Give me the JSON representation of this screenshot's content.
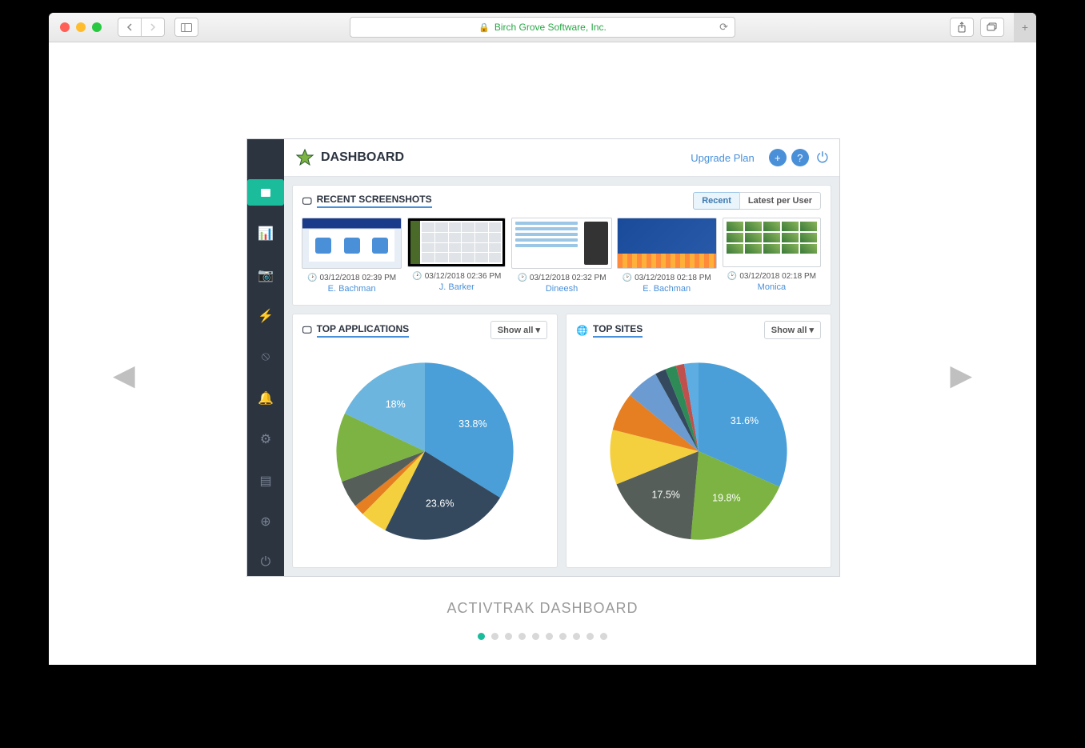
{
  "browser": {
    "page_title": "Birch Grove Software, Inc."
  },
  "caption": "ACTIVTRAK DASHBOARD",
  "pagers": {
    "count": 10,
    "active": 0
  },
  "header": {
    "title": "DASHBOARD",
    "upgrade": "Upgrade Plan"
  },
  "panels": {
    "screenshots": {
      "title": "RECENT SCREENSHOTS",
      "tabs": {
        "recent": "Recent",
        "latest": "Latest per User"
      }
    },
    "top_apps": {
      "title": "TOP APPLICATIONS",
      "dropdown": "Show all"
    },
    "top_sites": {
      "title": "TOP SITES",
      "dropdown": "Show all"
    }
  },
  "screenshots": [
    {
      "ts": "03/12/2018 02:39 PM",
      "user": "E. Bachman"
    },
    {
      "ts": "03/12/2018 02:36 PM",
      "user": "J. Barker"
    },
    {
      "ts": "03/12/2018 02:32 PM",
      "user": "Dineesh"
    },
    {
      "ts": "03/12/2018 02:18 PM",
      "user": "E. Bachman"
    },
    {
      "ts": "03/12/2018 02:18 PM",
      "user": "Monica"
    }
  ],
  "chart_data": [
    {
      "type": "pie",
      "title": "TOP APPLICATIONS",
      "slices": [
        {
          "value": 33.8,
          "color": "#4a9fd8",
          "label": "33.8%"
        },
        {
          "value": 23.6,
          "color": "#34495e",
          "label": "23.6%"
        },
        {
          "value": 5.0,
          "color": "#f4d03f",
          "label": ""
        },
        {
          "value": 2.0,
          "color": "#e67e22",
          "label": ""
        },
        {
          "value": 5.0,
          "color": "#555e58",
          "label": ""
        },
        {
          "value": 12.6,
          "color": "#7cb342",
          "label": ""
        },
        {
          "value": 18.0,
          "color": "#6bb5df",
          "label": "18%"
        }
      ]
    },
    {
      "type": "pie",
      "title": "TOP SITES",
      "slices": [
        {
          "value": 31.6,
          "color": "#4a9fd8",
          "label": "31.6%"
        },
        {
          "value": 19.8,
          "color": "#7cb342",
          "label": "19.8%"
        },
        {
          "value": 17.5,
          "color": "#555e58",
          "label": "17.5%"
        },
        {
          "value": 10.0,
          "color": "#f4d03f",
          "label": ""
        },
        {
          "value": 7.0,
          "color": "#e67e22",
          "label": ""
        },
        {
          "value": 6.0,
          "color": "#6b9bd1",
          "label": ""
        },
        {
          "value": 2.0,
          "color": "#34495e",
          "label": ""
        },
        {
          "value": 2.0,
          "color": "#2e8b57",
          "label": ""
        },
        {
          "value": 1.5,
          "color": "#c0504d",
          "label": ""
        },
        {
          "value": 2.6,
          "color": "#5dade2",
          "label": ""
        }
      ]
    }
  ]
}
